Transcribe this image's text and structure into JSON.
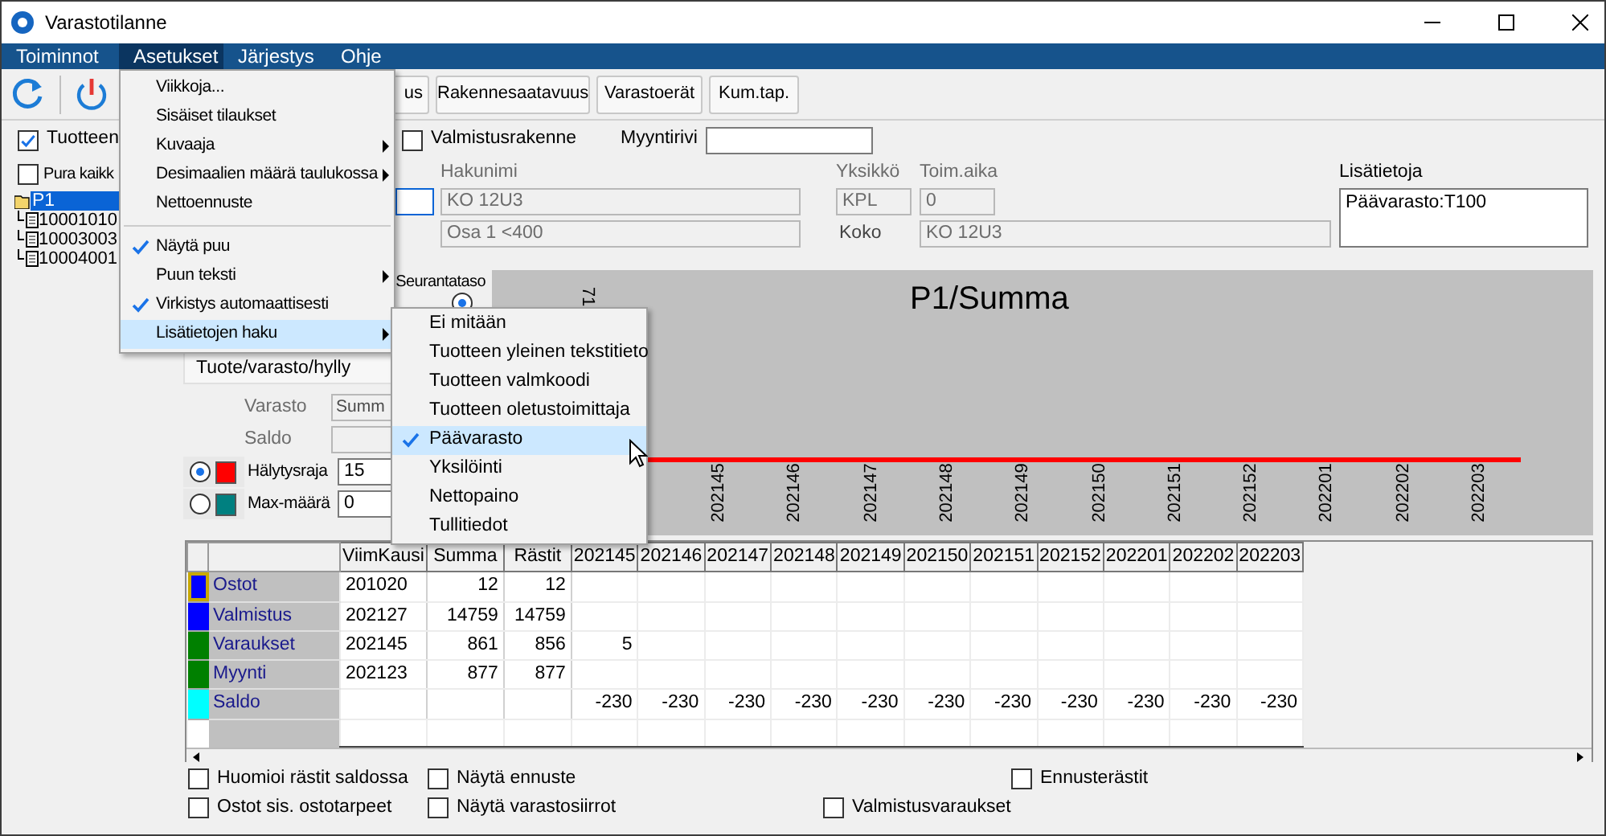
{
  "window": {
    "title": "Varastotilanne"
  },
  "menu_bar": [
    {
      "label": "Toiminnot",
      "selected": false
    },
    {
      "label": "Asetukset",
      "selected": true
    },
    {
      "label": "Järjestys",
      "selected": false
    },
    {
      "label": "Ohje",
      "selected": false
    }
  ],
  "open_menu": [
    {
      "kind": "item",
      "label": "Viikkoja...",
      "checked": false,
      "submenu": false,
      "selected": false
    },
    {
      "kind": "item",
      "label": "Sisäiset tilaukset",
      "checked": false,
      "submenu": false,
      "selected": false
    },
    {
      "kind": "item",
      "label": "Kuvaaja",
      "checked": false,
      "submenu": true,
      "selected": false
    },
    {
      "kind": "item",
      "label": "Desimaalien määrä taulukossa",
      "checked": false,
      "submenu": true,
      "selected": false
    },
    {
      "kind": "item",
      "label": "Nettoennuste",
      "checked": false,
      "submenu": false,
      "selected": false
    },
    {
      "kind": "separator"
    },
    {
      "kind": "item",
      "label": "Näytä puu",
      "checked": true,
      "submenu": false,
      "selected": false
    },
    {
      "kind": "item",
      "label": "Puun teksti",
      "checked": false,
      "submenu": true,
      "selected": false
    },
    {
      "kind": "item",
      "label": "Virkistys automaattisesti",
      "checked": true,
      "submenu": false,
      "selected": false
    },
    {
      "kind": "item",
      "label": "Lisätietojen haku",
      "checked": false,
      "submenu": true,
      "selected": true
    }
  ],
  "submenu": [
    {
      "label": "Ei mitään",
      "checked": false,
      "selected": false
    },
    {
      "label": "Tuotteen yleinen tekstitieto",
      "checked": false,
      "selected": false
    },
    {
      "label": "Tuotteen valmkoodi",
      "checked": false,
      "selected": false
    },
    {
      "label": "Tuotteen oletustoimittaja",
      "checked": false,
      "selected": false
    },
    {
      "label": "Päävarasto",
      "checked": true,
      "selected": true
    },
    {
      "label": "Yksilöinti",
      "checked": false,
      "selected": false
    },
    {
      "label": "Nettopaino",
      "checked": false,
      "selected": false
    },
    {
      "label": "Tullitiedot",
      "checked": false,
      "selected": false
    }
  ],
  "toolbar_buttons": [
    "us",
    "Rakennesaatavuus",
    "Varastoerät",
    "Kum.tap."
  ],
  "options": {
    "show_product": {
      "label": "Tuotteen",
      "checked": true
    },
    "structure": {
      "label": "Valmistusrakenne",
      "checked": false
    },
    "sales_row_label": "Myyntirivi"
  },
  "tree": {
    "expand_all": {
      "label": "Pura kaikk",
      "checked": false
    },
    "root": {
      "label": "P1",
      "selected": true,
      "children": [
        {
          "label": "10001010",
          "selected": false
        },
        {
          "label": "10003003",
          "selected": false
        },
        {
          "label": "10004001",
          "selected": false
        }
      ]
    }
  },
  "product": {
    "hakunimi_label": "Hakunimi",
    "hakunimi": "KO 12U3",
    "description": "Osa 1 <400",
    "unit_label": "Yksikkö",
    "unit": "KPL",
    "lead_time_label": "Toim.aika",
    "lead_time": "0",
    "size_label": "Koko",
    "size": "KO 12U3",
    "info_label": "Lisätietoja",
    "info": "Päävarasto:T100"
  },
  "tracking": {
    "label": "Seurantataso",
    "selected": true,
    "level_tab": "Tuote/varasto/hylly"
  },
  "warehouse": {
    "label": "Varasto",
    "value": "Summ"
  },
  "balance": {
    "label": "Saldo"
  },
  "limits": [
    {
      "label": "Hälytysraja",
      "value": "15",
      "selected": true,
      "color": "#ff0000"
    },
    {
      "label": "Max-määrä",
      "value": "0",
      "selected": false,
      "color": "#008080"
    }
  ],
  "chart": {
    "title": "P1/Summa",
    "axis_fragment": "71",
    "x_labels": [
      "202145",
      "202146",
      "202147",
      "202148",
      "202149",
      "202150",
      "202151",
      "202152",
      "202201",
      "202202",
      "202203"
    ]
  },
  "table": {
    "columns": [
      "ViimKausi",
      "Summa",
      "Rästit",
      "202145",
      "202146",
      "202147",
      "202148",
      "202149",
      "202150",
      "202151",
      "202152",
      "202201",
      "202202",
      "202203"
    ],
    "rows": [
      {
        "label": "Ostot",
        "color": "#0000ff",
        "selected": true,
        "cells": [
          "201020",
          "12",
          "12",
          null,
          null,
          null,
          null,
          null,
          null,
          null,
          null,
          null,
          null,
          null
        ]
      },
      {
        "label": "Valmistus",
        "color": "#0000ff",
        "selected": false,
        "cells": [
          "202127",
          "14759",
          "14759",
          null,
          null,
          null,
          null,
          null,
          null,
          null,
          null,
          null,
          null,
          null
        ]
      },
      {
        "label": "Varaukset",
        "color": "#008000",
        "selected": false,
        "cells": [
          "202145",
          "861",
          "856",
          "5",
          null,
          null,
          null,
          null,
          null,
          null,
          null,
          null,
          null,
          null
        ]
      },
      {
        "label": "Myynti",
        "color": "#008000",
        "selected": false,
        "cells": [
          "202123",
          "877",
          "877",
          null,
          null,
          null,
          null,
          null,
          null,
          null,
          null,
          null,
          null,
          null
        ]
      },
      {
        "label": "Saldo",
        "color": "#00ffff",
        "selected": false,
        "cells": [
          null,
          null,
          null,
          "-230",
          "-230",
          "-230",
          "-230",
          "-230",
          "-230",
          "-230",
          "-230",
          "-230",
          "-230",
          "-230"
        ]
      }
    ]
  },
  "footer_rows": [
    [
      {
        "label": "Huomioi rästit saldossa",
        "checked": false
      },
      {
        "label": "Näytä ennuste",
        "checked": false
      },
      {
        "label": "Ennusterästit",
        "checked": false
      }
    ],
    [
      {
        "label": "Ostot sis. ostotarpeet",
        "checked": false
      },
      {
        "label": "Näytä varastosiirrot",
        "checked": false
      },
      {
        "label": "Valmistusvaraukset",
        "checked": false
      }
    ]
  ]
}
